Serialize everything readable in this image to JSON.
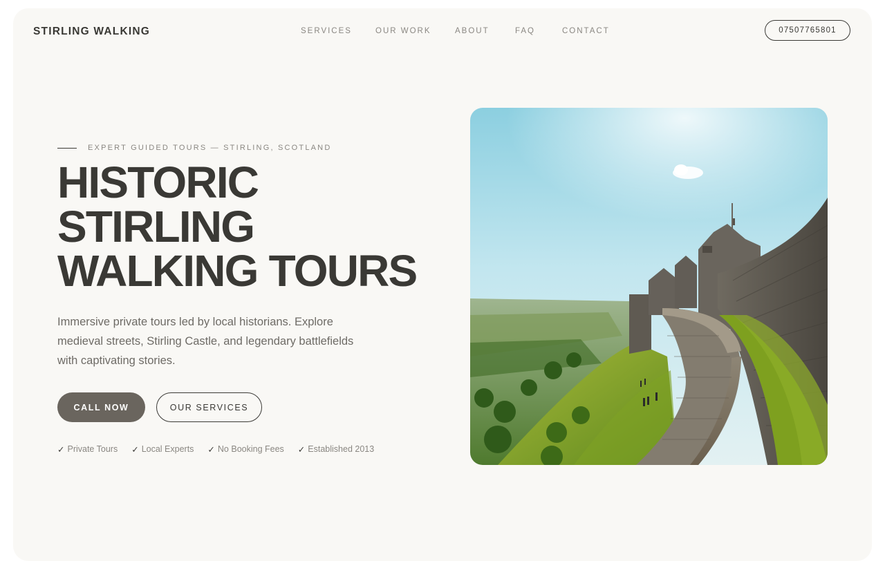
{
  "header": {
    "brand": "STIRLING WALKING",
    "nav": [
      "SERVICES",
      "OUR WORK",
      "ABOUT",
      "FAQ",
      "CONTACT"
    ],
    "phone": "07507765801"
  },
  "hero": {
    "eyebrow": "EXPERT GUIDED TOURS — STIRLING, SCOTLAND",
    "headline": [
      "HISTORIC",
      "STIRLING",
      "WALKING TOURS"
    ],
    "lead": "Immersive private tours led by local historians. Explore medieval streets, Stirling Castle, and legendary battlefields with captivating stories.",
    "primary_button": "CALL NOW",
    "secondary_button": "OUR SERVICES",
    "features": [
      "Private Tours",
      "Local Experts",
      "No Booking Fees",
      "Established 2013"
    ],
    "check_glyph": "✓",
    "image_icon": "castle-wall-photo"
  },
  "colors": {
    "text_dark": "#3a3935",
    "text_muted": "#8a8782",
    "page_bg": "#f9f8f5",
    "primary_button_bg": "#6a655e"
  }
}
